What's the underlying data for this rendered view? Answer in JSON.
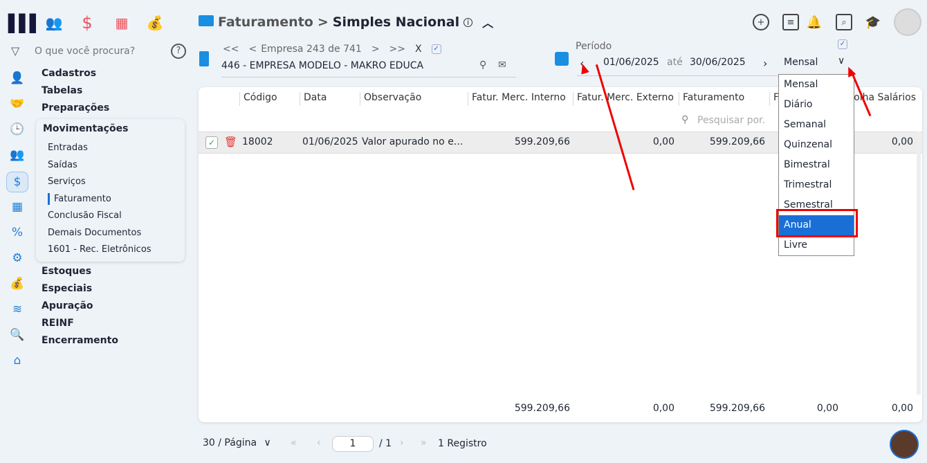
{
  "topbar": {
    "breadcrumb_parent": "Faturamento",
    "breadcrumb_sep": ">",
    "title": "Simples Nacional"
  },
  "sidebar": {
    "search_placeholder": "O que você procura?",
    "menu": [
      "Cadastros",
      "Tabelas",
      "Preparações"
    ],
    "active_group": "Movimentações",
    "sub_items": [
      "Entradas",
      "Saídas",
      "Serviços",
      "Faturamento",
      "Conclusão Fiscal",
      "Demais Documentos",
      "1601 - Rec. Eletrônicos"
    ],
    "menu_after": [
      "Estoques",
      "Especiais",
      "Apuração",
      "REINF",
      "Encerramento"
    ]
  },
  "empresa": {
    "nav_first": "<<",
    "nav_prev": "<",
    "label": "Empresa 243 de 741",
    "nav_next": ">",
    "nav_last": ">>",
    "close": "X",
    "value": "446 - EMPRESA MODELO  - MAKRO EDUCA"
  },
  "periodo": {
    "label": "Período",
    "start": "01/06/2025",
    "sep": "até",
    "end": "30/06/2025",
    "mode": "Mensal",
    "options": [
      "Mensal",
      "Diário",
      "Semanal",
      "Quinzenal",
      "Bimestral",
      "Trimestral",
      "Semestral",
      "Anual",
      "Livre"
    ],
    "highlighted": "Anual"
  },
  "table": {
    "headers": [
      "Código",
      "Data",
      "Observação",
      "Fatur. Merc. Interno",
      "Fatur. Merc. Externo",
      "Faturamento",
      "F",
      "Folha Salários"
    ],
    "search_placeholder": "Pesquisar por.",
    "rows": [
      {
        "codigo": "18002",
        "data": "01/06/2025",
        "obs": "Valor apurado no e...",
        "interno": "599.209,66",
        "externo": "0,00",
        "faturamento": "599.209,66",
        "folha": "0,00"
      }
    ],
    "totals": {
      "interno": "599.209,66",
      "externo": "0,00",
      "faturamento": "599.209,66",
      "col8": "0,00",
      "folha": "0,00"
    }
  },
  "pagination": {
    "per_page": "30 / Página",
    "page": "1",
    "total_pages": "/ 1",
    "records": "1 Registro"
  },
  "colors": {
    "accent": "#1a6fd6",
    "highlight_border": "#e00000"
  }
}
